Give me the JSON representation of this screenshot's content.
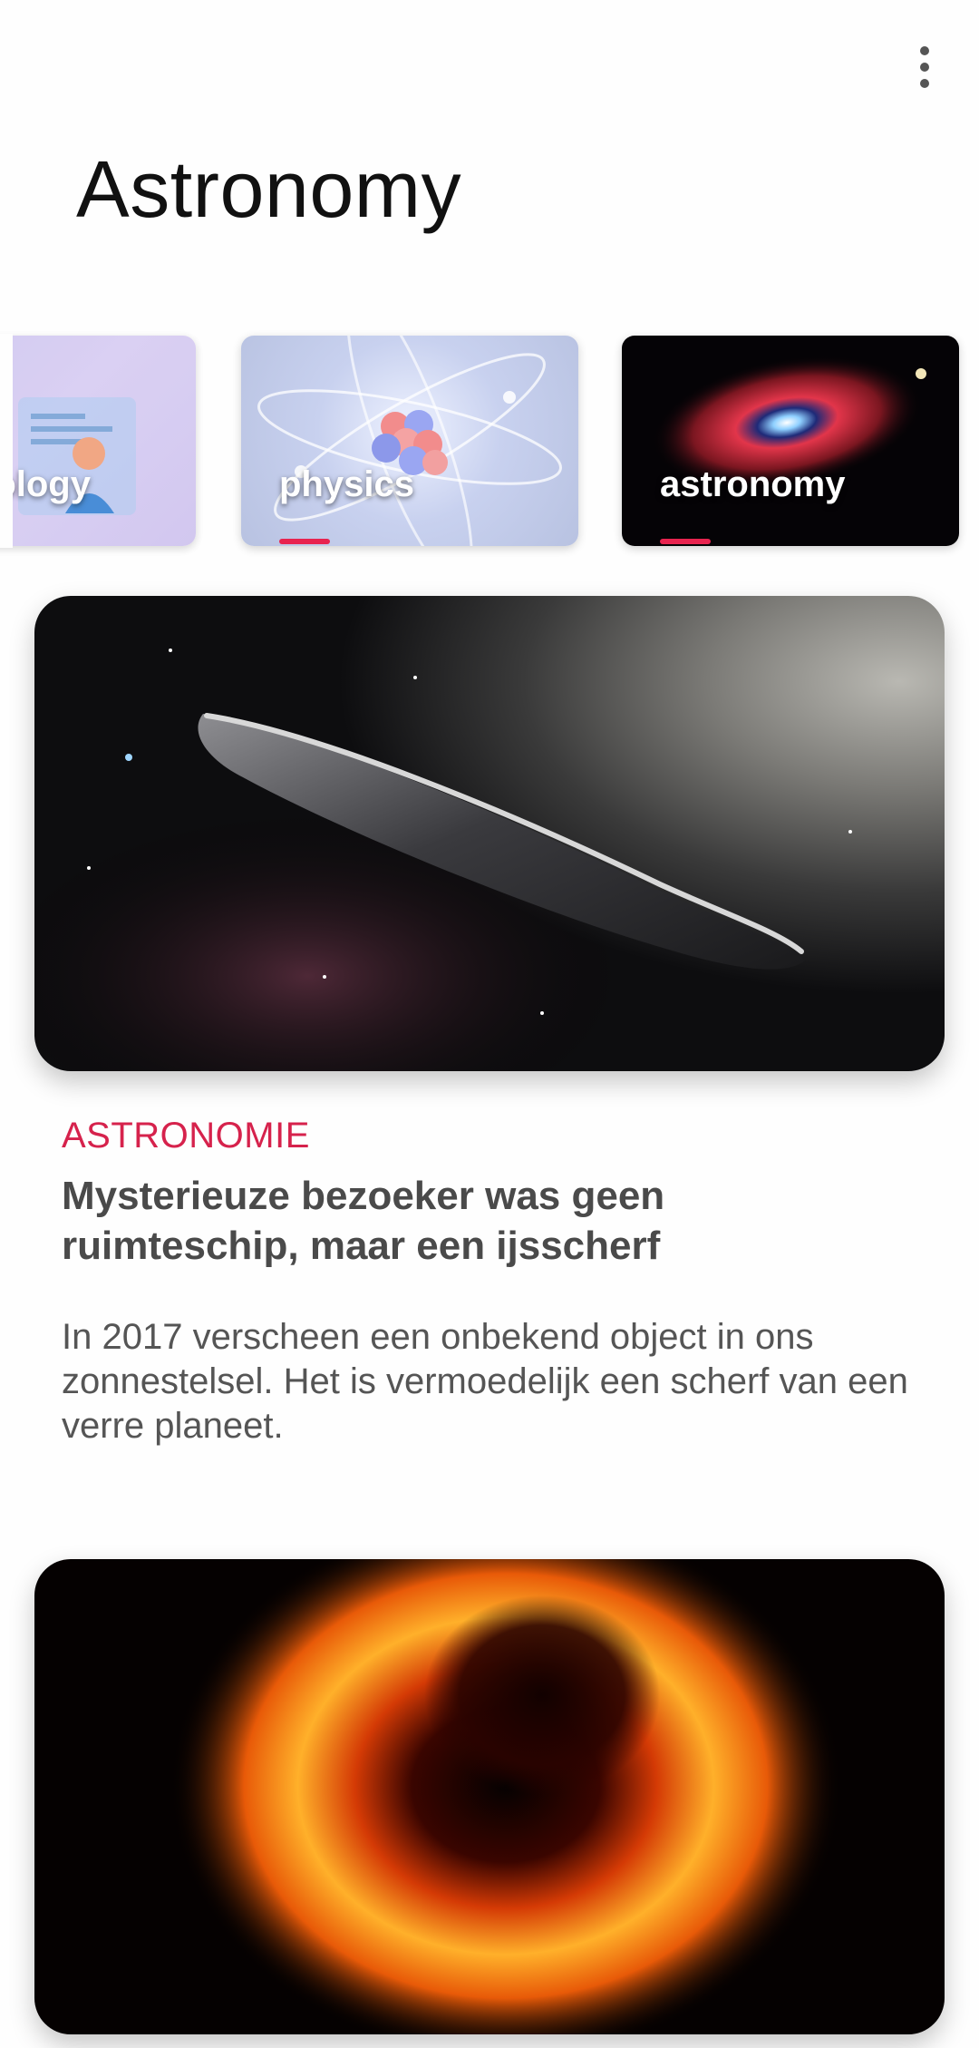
{
  "header": {
    "title": "Astronomy",
    "menu_icon": "more-vertical-icon"
  },
  "categories": {
    "items": [
      {
        "label": "technology",
        "visible_fragment": "ology"
      },
      {
        "label": "physics"
      },
      {
        "label": "astronomy"
      }
    ]
  },
  "articles": [
    {
      "category": "ASTRONOMIE",
      "headline": "Mysterieuze bezoeker was geen ruimteschip, maar een ijsscherf",
      "summary": "In 2017 verscheen een onbekend object in ons zonnestelsel. Het is vermoedelijk een scherf van een verre planeet."
    }
  ],
  "colors": {
    "accent": "#d6224c",
    "indicator": "#e8234f",
    "headline": "#4a4a4a",
    "body": "#555555"
  }
}
